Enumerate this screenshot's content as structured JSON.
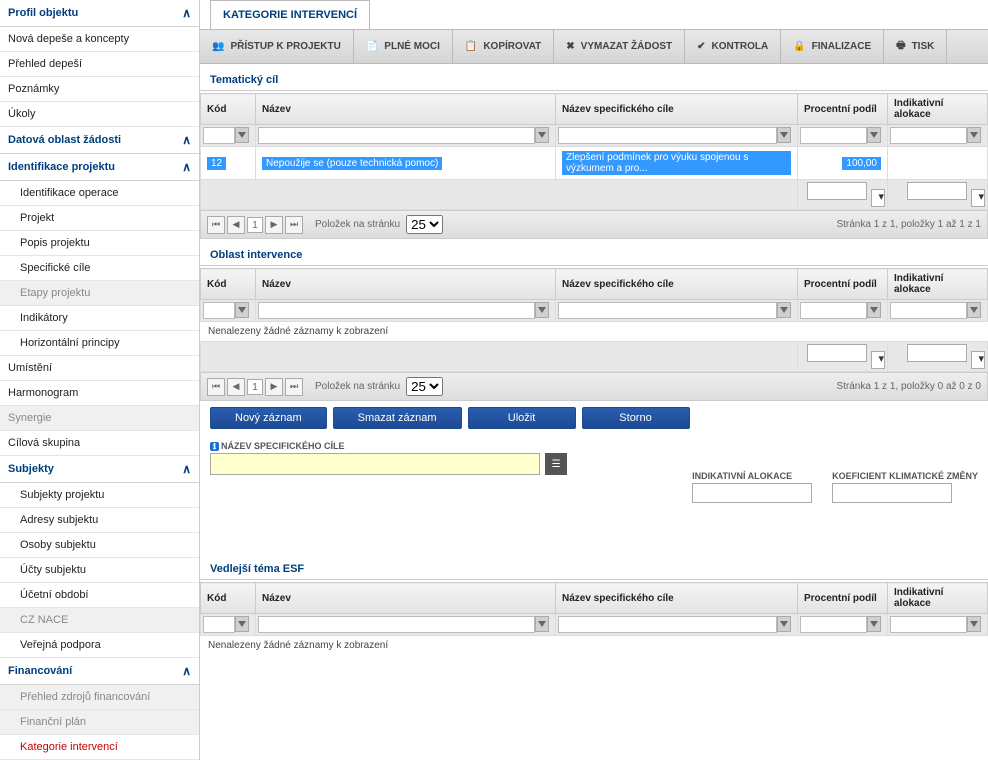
{
  "sidebar": {
    "sections": [
      {
        "label": "Profil objektu",
        "collapsible": true,
        "items": [
          {
            "label": "Nová depeše a koncepty"
          },
          {
            "label": "Přehled depeší"
          },
          {
            "label": "Poznámky"
          },
          {
            "label": "Úkoly"
          }
        ]
      },
      {
        "label": "Datová oblast žádosti",
        "collapsible": true,
        "items": []
      },
      {
        "label": "Identifikace projektu",
        "collapsible": true,
        "items": [
          {
            "label": "Identifikace operace"
          },
          {
            "label": "Projekt"
          },
          {
            "label": "Popis projektu"
          },
          {
            "label": "Specifické cíle"
          },
          {
            "label": "Etapy projektu",
            "gray": true
          },
          {
            "label": "Indikátory"
          },
          {
            "label": "Horizontální principy"
          }
        ]
      },
      {
        "label": "Umístění",
        "plain": true
      },
      {
        "label": "Harmonogram",
        "plain": true
      },
      {
        "label": "Synergie",
        "plain": true,
        "gray": true
      },
      {
        "label": "Cílová skupina",
        "plain": true
      },
      {
        "label": "Subjekty",
        "collapsible": true,
        "items": [
          {
            "label": "Subjekty projektu"
          },
          {
            "label": "Adresy subjektu"
          },
          {
            "label": "Osoby subjektu"
          },
          {
            "label": "Účty subjektu"
          },
          {
            "label": "Účetní období"
          },
          {
            "label": "CZ NACE",
            "gray": true
          },
          {
            "label": "Veřejná podpora"
          }
        ]
      },
      {
        "label": "Financování",
        "collapsible": true,
        "items": [
          {
            "label": "Přehled zdrojů financování",
            "gray": true
          },
          {
            "label": "Finanční plán",
            "gray": true
          },
          {
            "label": "Kategorie intervencí",
            "red": true
          }
        ]
      }
    ]
  },
  "tab": "KATEGORIE INTERVENCÍ",
  "toolbar": [
    {
      "label": "PŘÍSTUP K PROJEKTU"
    },
    {
      "label": "PLNÉ MOCI"
    },
    {
      "label": "KOPÍROVAT"
    },
    {
      "label": "VYMAZAT ŽÁDOST"
    },
    {
      "label": "KONTROLA"
    },
    {
      "label": "FINALIZACE"
    },
    {
      "label": "TISK"
    }
  ],
  "grids": {
    "columns": {
      "kod": "Kód",
      "nazev": "Název",
      "nazev_spec": "Název specifického cíle",
      "procent": "Procentní podíl",
      "indik": "Indikativní alokace"
    },
    "tematicky": {
      "title": "Tematický cíl",
      "row": {
        "kod": "12",
        "nazev": "Nepoužije se (pouze technická pomoc)",
        "nazev_spec": "Zlepšení podmínek pro výuku spojenou s výzkumem a pro...",
        "procent": "100,00",
        "indik": ""
      },
      "pager_info": "Stránka 1 z 1, položky 1 až 1 z 1"
    },
    "oblast": {
      "title": "Oblast intervence",
      "empty": "Nenalezeny žádné záznamy k zobrazení",
      "pager_info": "Stránka 1 z 1, položky 0 až 0 z 0"
    },
    "vedlejsi": {
      "title": "Vedlejší téma ESF",
      "empty": "Nenalezeny žádné záznamy k zobrazení"
    }
  },
  "pager": {
    "per_page_label": "Položek na stránku",
    "per_page": "25",
    "page": "1"
  },
  "buttons": {
    "new": "Nový záznam",
    "delete": "Smazat záznam",
    "save": "Uložit",
    "cancel": "Storno"
  },
  "form": {
    "spec_label": "NÁZEV SPECIFICKÉHO CÍLE",
    "indik_label": "INDIKATIVNÍ ALOKACE",
    "koef_label": "KOEFICIENT KLIMATICKÉ ZMĚNY"
  }
}
